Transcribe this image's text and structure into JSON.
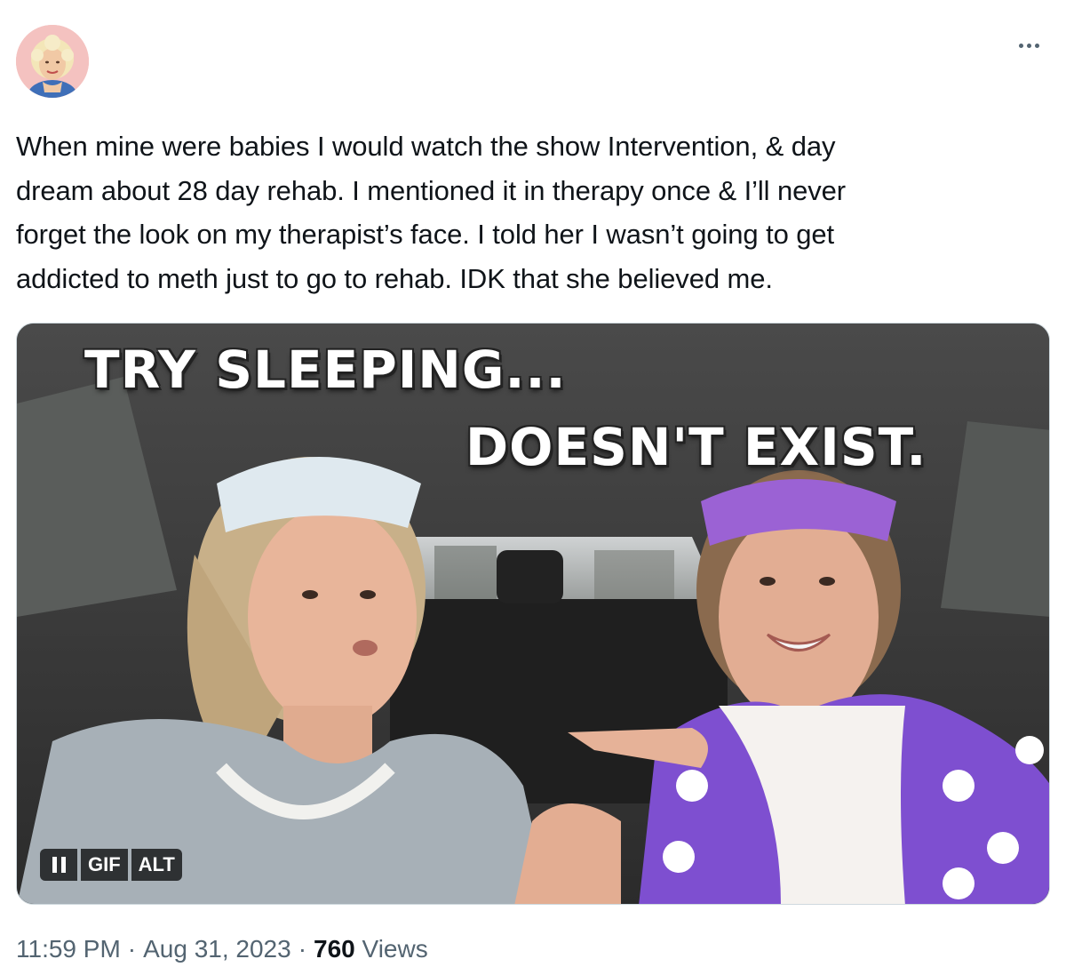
{
  "tweet": {
    "more_label": "…",
    "text": "When mine were babies I would watch the show Intervention, & day\ndream about 28 day rehab. I mentioned it in therapy once & I’ll never\nforget the look on my therapist’s face. I told her I wasn’t going to get\naddicted to meth just to go to rehab. IDK that she believed me."
  },
  "media": {
    "caption_line1": "TRY SLEEPING...",
    "caption_line2": "DOESN'T EXIST.",
    "controls": {
      "pause_icon": "pause-icon",
      "gif_label": "GIF",
      "alt_label": "ALT"
    }
  },
  "meta": {
    "time": "11:59 PM",
    "separator": "·",
    "date": "Aug 31, 2023",
    "views_count": "760",
    "views_label": "Views"
  },
  "colors": {
    "text_primary": "#0f1419",
    "text_secondary": "#536471",
    "border": "#cfd9de"
  }
}
